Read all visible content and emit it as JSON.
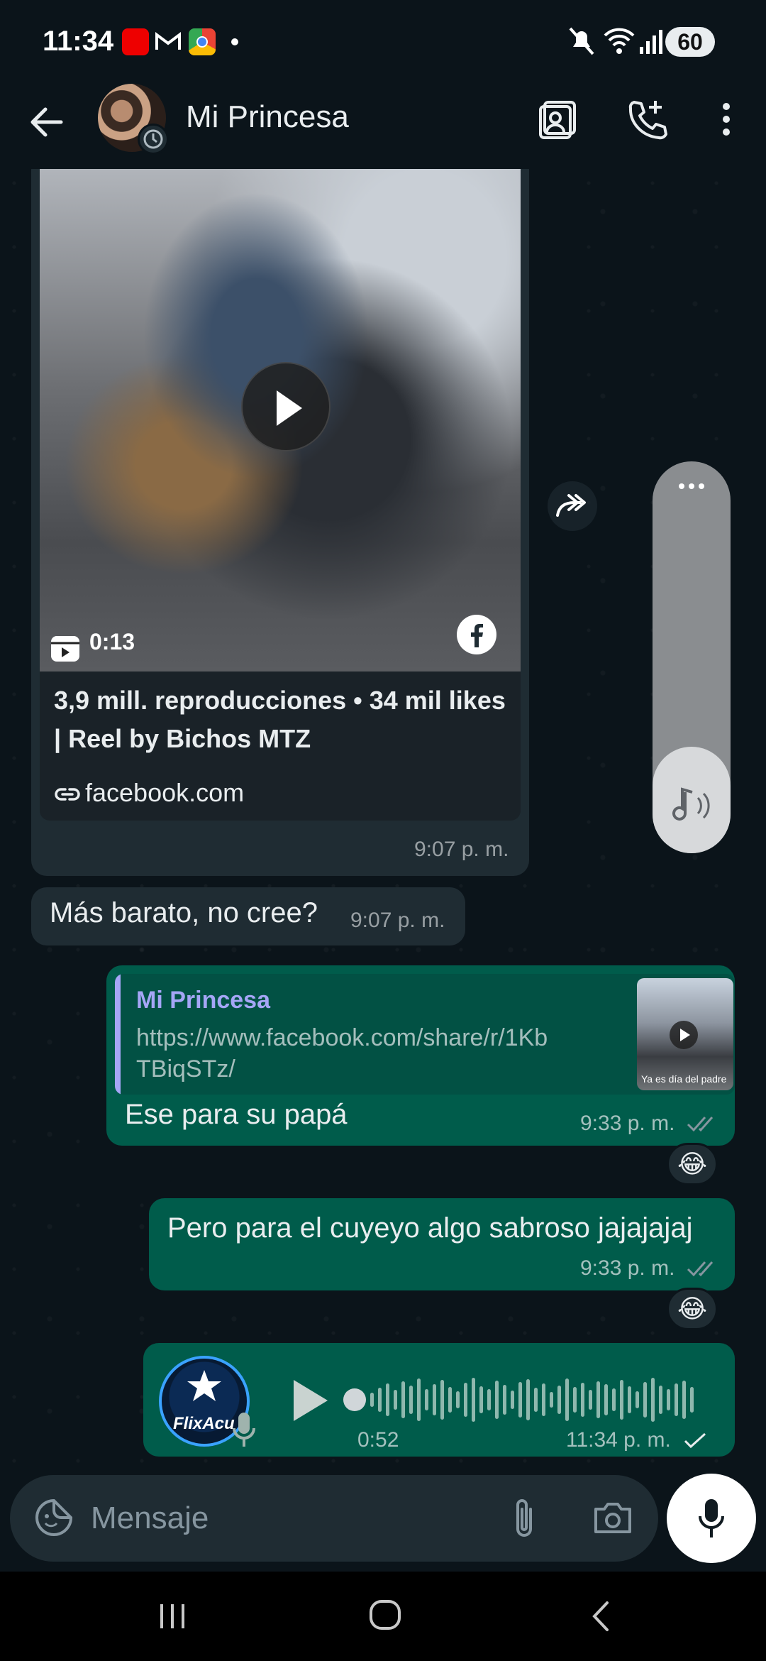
{
  "status_bar": {
    "time": "11:34",
    "battery": "60",
    "app_icons": [
      "adobe-acrobat-icon",
      "gmail-icon",
      "chrome-icon"
    ]
  },
  "header": {
    "contact_name": "Mi Princesa",
    "icons": [
      "back-arrow-icon",
      "contact-card-icon",
      "add-call-icon",
      "more-vert-icon"
    ]
  },
  "messages": {
    "shared_reel": {
      "duration": "0:13",
      "title": "3,9 mill. reproducciones • 34 mil likes | Reel by Bichos MTZ",
      "link": "facebook.com",
      "time": "9:07 p. m."
    },
    "incoming_text": {
      "text": "Más barato, no cree?",
      "time": "9:07 p. m."
    },
    "reply": {
      "quoted_name": "Mi Princesa",
      "quoted_url": "https://www.facebook.com/share/r/1KbTBiqSTz/",
      "thumb_caption": "Ya es día del padre",
      "text": "Ese para su papá",
      "time": "9:33 p. m.",
      "reaction": "😂"
    },
    "outgoing_text": {
      "text": "Pero para el cuyeyo algo sabroso jajajajaj",
      "time": "9:33 p. m.",
      "reaction": "😂"
    },
    "voice_note": {
      "avatar_label": "FlixAcu",
      "duration": "0:52",
      "time": "11:34 p. m."
    }
  },
  "composer": {
    "placeholder": "Mensaje"
  },
  "colors": {
    "background": "#0b141a",
    "incoming_bubble": "#1f2c33",
    "outgoing_bubble": "#005c4b",
    "quote_accent": "#a5a6f6",
    "read_ticks": "#8696a0"
  }
}
